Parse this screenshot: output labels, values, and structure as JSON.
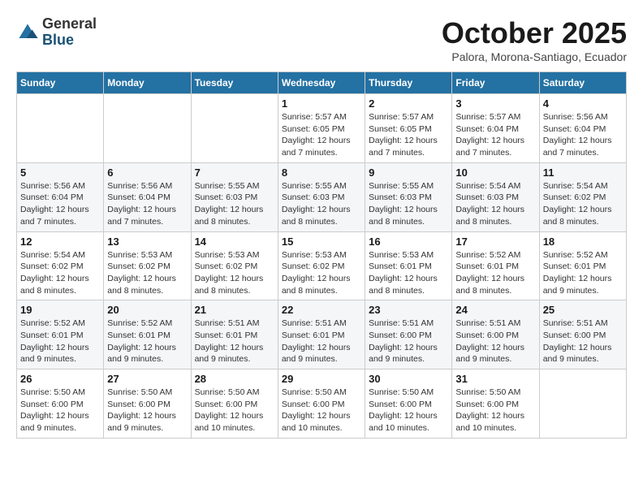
{
  "header": {
    "logo_line1": "General",
    "logo_line2": "Blue",
    "month_title": "October 2025",
    "subtitle": "Palora, Morona-Santiago, Ecuador"
  },
  "weekdays": [
    "Sunday",
    "Monday",
    "Tuesday",
    "Wednesday",
    "Thursday",
    "Friday",
    "Saturday"
  ],
  "weeks": [
    [
      {
        "day": "",
        "info": ""
      },
      {
        "day": "",
        "info": ""
      },
      {
        "day": "",
        "info": ""
      },
      {
        "day": "1",
        "info": "Sunrise: 5:57 AM\nSunset: 6:05 PM\nDaylight: 12 hours and 7 minutes."
      },
      {
        "day": "2",
        "info": "Sunrise: 5:57 AM\nSunset: 6:05 PM\nDaylight: 12 hours and 7 minutes."
      },
      {
        "day": "3",
        "info": "Sunrise: 5:57 AM\nSunset: 6:04 PM\nDaylight: 12 hours and 7 minutes."
      },
      {
        "day": "4",
        "info": "Sunrise: 5:56 AM\nSunset: 6:04 PM\nDaylight: 12 hours and 7 minutes."
      }
    ],
    [
      {
        "day": "5",
        "info": "Sunrise: 5:56 AM\nSunset: 6:04 PM\nDaylight: 12 hours and 7 minutes."
      },
      {
        "day": "6",
        "info": "Sunrise: 5:56 AM\nSunset: 6:04 PM\nDaylight: 12 hours and 7 minutes."
      },
      {
        "day": "7",
        "info": "Sunrise: 5:55 AM\nSunset: 6:03 PM\nDaylight: 12 hours and 8 minutes."
      },
      {
        "day": "8",
        "info": "Sunrise: 5:55 AM\nSunset: 6:03 PM\nDaylight: 12 hours and 8 minutes."
      },
      {
        "day": "9",
        "info": "Sunrise: 5:55 AM\nSunset: 6:03 PM\nDaylight: 12 hours and 8 minutes."
      },
      {
        "day": "10",
        "info": "Sunrise: 5:54 AM\nSunset: 6:03 PM\nDaylight: 12 hours and 8 minutes."
      },
      {
        "day": "11",
        "info": "Sunrise: 5:54 AM\nSunset: 6:02 PM\nDaylight: 12 hours and 8 minutes."
      }
    ],
    [
      {
        "day": "12",
        "info": "Sunrise: 5:54 AM\nSunset: 6:02 PM\nDaylight: 12 hours and 8 minutes."
      },
      {
        "day": "13",
        "info": "Sunrise: 5:53 AM\nSunset: 6:02 PM\nDaylight: 12 hours and 8 minutes."
      },
      {
        "day": "14",
        "info": "Sunrise: 5:53 AM\nSunset: 6:02 PM\nDaylight: 12 hours and 8 minutes."
      },
      {
        "day": "15",
        "info": "Sunrise: 5:53 AM\nSunset: 6:02 PM\nDaylight: 12 hours and 8 minutes."
      },
      {
        "day": "16",
        "info": "Sunrise: 5:53 AM\nSunset: 6:01 PM\nDaylight: 12 hours and 8 minutes."
      },
      {
        "day": "17",
        "info": "Sunrise: 5:52 AM\nSunset: 6:01 PM\nDaylight: 12 hours and 8 minutes."
      },
      {
        "day": "18",
        "info": "Sunrise: 5:52 AM\nSunset: 6:01 PM\nDaylight: 12 hours and 9 minutes."
      }
    ],
    [
      {
        "day": "19",
        "info": "Sunrise: 5:52 AM\nSunset: 6:01 PM\nDaylight: 12 hours and 9 minutes."
      },
      {
        "day": "20",
        "info": "Sunrise: 5:52 AM\nSunset: 6:01 PM\nDaylight: 12 hours and 9 minutes."
      },
      {
        "day": "21",
        "info": "Sunrise: 5:51 AM\nSunset: 6:01 PM\nDaylight: 12 hours and 9 minutes."
      },
      {
        "day": "22",
        "info": "Sunrise: 5:51 AM\nSunset: 6:01 PM\nDaylight: 12 hours and 9 minutes."
      },
      {
        "day": "23",
        "info": "Sunrise: 5:51 AM\nSunset: 6:00 PM\nDaylight: 12 hours and 9 minutes."
      },
      {
        "day": "24",
        "info": "Sunrise: 5:51 AM\nSunset: 6:00 PM\nDaylight: 12 hours and 9 minutes."
      },
      {
        "day": "25",
        "info": "Sunrise: 5:51 AM\nSunset: 6:00 PM\nDaylight: 12 hours and 9 minutes."
      }
    ],
    [
      {
        "day": "26",
        "info": "Sunrise: 5:50 AM\nSunset: 6:00 PM\nDaylight: 12 hours and 9 minutes."
      },
      {
        "day": "27",
        "info": "Sunrise: 5:50 AM\nSunset: 6:00 PM\nDaylight: 12 hours and 9 minutes."
      },
      {
        "day": "28",
        "info": "Sunrise: 5:50 AM\nSunset: 6:00 PM\nDaylight: 12 hours and 10 minutes."
      },
      {
        "day": "29",
        "info": "Sunrise: 5:50 AM\nSunset: 6:00 PM\nDaylight: 12 hours and 10 minutes."
      },
      {
        "day": "30",
        "info": "Sunrise: 5:50 AM\nSunset: 6:00 PM\nDaylight: 12 hours and 10 minutes."
      },
      {
        "day": "31",
        "info": "Sunrise: 5:50 AM\nSunset: 6:00 PM\nDaylight: 12 hours and 10 minutes."
      },
      {
        "day": "",
        "info": ""
      }
    ]
  ]
}
